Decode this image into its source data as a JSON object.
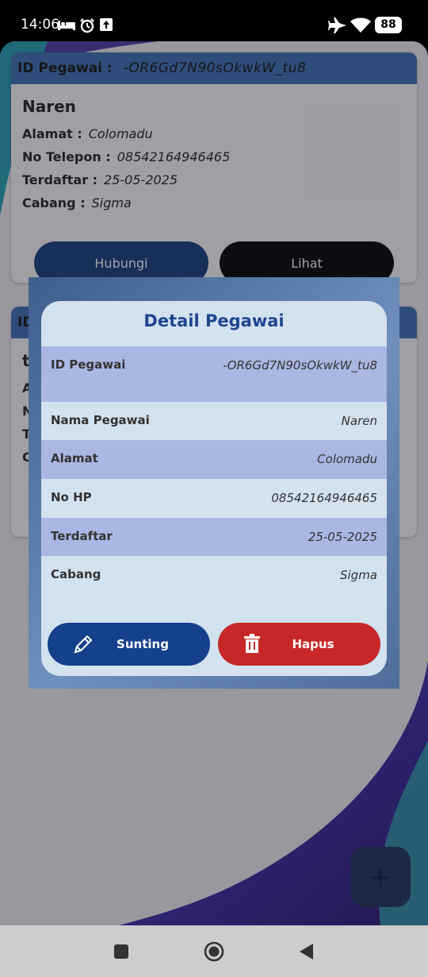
{
  "status_bar": {
    "time": "14:06",
    "battery": "88",
    "icons": [
      "bed-icon",
      "alarm-icon",
      "upload-icon",
      "airplane-icon",
      "wifi-icon",
      "battery-icon"
    ]
  },
  "cards": [
    {
      "id_label": "ID Pegawai :",
      "id_value": "-OR6Gd7N90sOkwkW_tu8",
      "name": "Naren",
      "rows": [
        {
          "label": "Alamat :",
          "value": "Colomadu"
        },
        {
          "label": "No Telepon :",
          "value": "08542164946465"
        },
        {
          "label": "Terdaftar :",
          "value": "25-05-2025"
        },
        {
          "label": "Cabang :",
          "value": "Sigma"
        }
      ],
      "btn_contact": "Hubungi",
      "btn_view": "Lihat"
    },
    {
      "id_label": "ID",
      "name": "t",
      "row_initials": [
        "A",
        "N",
        "T",
        "C"
      ]
    }
  ],
  "dialog": {
    "title": "Detail Pegawai",
    "rows": [
      {
        "label": "ID Pegawai",
        "value": "-OR6Gd7N90sOkwkW_tu8"
      },
      {
        "label": "Nama Pegawai",
        "value": "Naren"
      },
      {
        "label": "Alamat",
        "value": "Colomadu"
      },
      {
        "label": "No HP",
        "value": "08542164946465"
      },
      {
        "label": "Terdaftar",
        "value": "25-05-2025"
      },
      {
        "label": "Cabang",
        "value": "Sigma"
      }
    ],
    "edit_label": "Sunting",
    "delete_label": "Hapus"
  },
  "fab": {
    "icon": "plus-icon",
    "label": "+"
  },
  "nav": {
    "icons": [
      "recent-apps-icon",
      "home-icon",
      "back-icon"
    ]
  },
  "colors": {
    "card_header": "#3a6fb6",
    "contact_button": "#133b7c",
    "view_button": "#000000",
    "dialog_bg": "#d3e2ef",
    "dialog_row_alt": "#aab7e3",
    "edit_button": "#15408b",
    "delete_button": "#c62828",
    "title_color": "#1e4690"
  }
}
